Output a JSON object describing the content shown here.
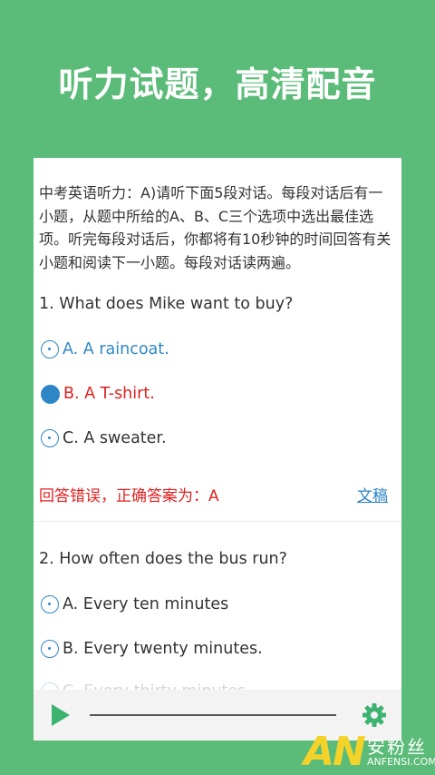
{
  "banner": {
    "title": "听力试题，高清配音"
  },
  "exercise": {
    "intro": "中考英语听力：A)请听下面5段对话。每段对话后有一小题，从题中所给的A、B、C三个选项中选出最佳选项。听完每段对话后，你都将有10秒钟的时间回答有关小题和阅读下一小题。每段对话读两遍。",
    "q1": {
      "text": "1. What does Mike want to buy?",
      "options": [
        "A. A raincoat.",
        "B. A T-shirt.",
        "C. A sweater."
      ]
    },
    "result": "回答错误，正确答案为：A",
    "transcript_link": "文稿",
    "q2": {
      "text": "2. How often does the bus run?",
      "options": [
        "A. Every ten minutes",
        "B. Every twenty minutes.",
        "C. Every thirty minutes."
      ]
    }
  },
  "player": {
    "progress": 0
  },
  "watermark": {
    "logo": "AN",
    "name": "安粉丝",
    "domain": "ANFENSI.COM"
  },
  "colors": {
    "background": "#5bbb78",
    "accent": "#2f86c7",
    "error": "#e02020",
    "gear": "#3cb371"
  }
}
